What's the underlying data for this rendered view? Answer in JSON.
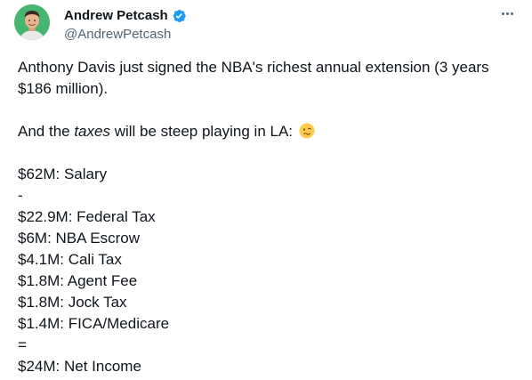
{
  "author": {
    "display_name": "Andrew Petcash",
    "handle": "@AndrewPetcash",
    "verified_color": "#1d9bf0",
    "avatar_color": "#3cb371"
  },
  "tweet": {
    "intro_line1": "Anthony Davis just signed the NBA's richest annual extension (3 years",
    "intro_line2": "$186 million).",
    "taxes_prefix": "And the ",
    "taxes_word": "taxes",
    "taxes_suffix": " will be steep playing in LA:",
    "emoji_icon": "woozy-face-emoji",
    "breakdown": {
      "salary": "$62M: Salary",
      "minus": "-",
      "federal": "$22.9M: Federal Tax",
      "escrow": "$6M: NBA Escrow",
      "cali": "$4.1M: Cali Tax",
      "agent": "$1.8M: Agent Fee",
      "jock": "$1.8M: Jock Tax",
      "fica": "$1.4M: FICA/Medicare",
      "equals": "=",
      "net": "$24M: Net Income"
    }
  },
  "icons": {
    "more": "more-options-icon",
    "verified": "verified-badge-icon"
  }
}
